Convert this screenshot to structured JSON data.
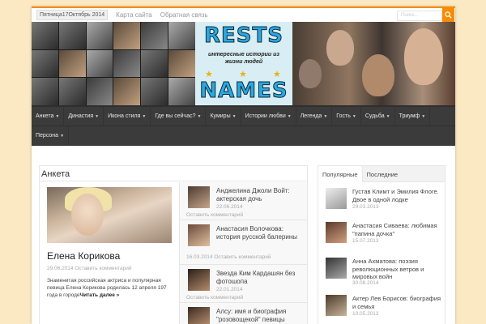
{
  "topbar": {
    "date": "Пятница17Октябрь 2014",
    "links": [
      "Карта сайта",
      "Обратная связь"
    ],
    "search_placeholder": "Поиск..."
  },
  "logo": {
    "top": "RESTS",
    "tagline": "интересные истории из жизни людей",
    "bottom": "NAMES"
  },
  "nav": {
    "row1": [
      "Анкета",
      "Династия",
      "Икона стиля",
      "Где вы сейчас?",
      "Кумиры",
      "Истории любви",
      "Легенда",
      "Гость",
      "Судьба",
      "Триумф"
    ],
    "row2": [
      "Персона"
    ]
  },
  "main": {
    "title": "Анкета",
    "feature": {
      "name": "Елена Корикова",
      "date": "29.06.2014",
      "comment": "Оставить комментарий",
      "text": "Знаменитая российская актриса и популярная певица Елена Корикова родилась 12 апреля 197 года в городе",
      "readmore": "Читать далее »"
    },
    "list": [
      {
        "title": "Анджелина Джоли Войт: актерская дочь",
        "date": "22.06.2014",
        "comment": "Оставить комментарий"
      },
      {
        "title": "Анастасия Волочкова: история русской балерины",
        "date": "16.03.2014",
        "comment": "Оставить комментарий"
      },
      {
        "title": "Звезда Ким Кардашян без фотошопа",
        "date": "22.01.2014",
        "comment": "Оставить комментарий"
      },
      {
        "title": "Алсу: имя и биография \"розовощекой\" певицы",
        "date": "",
        "comment": ""
      }
    ]
  },
  "sidebar": {
    "tabs": [
      "Популярные",
      "Последние"
    ],
    "items": [
      {
        "title": "Густав Климт и Эмилия Флоге. Двое в одной лодке",
        "date": "29.03.2013"
      },
      {
        "title": "Анастасия Сиваева: любимая \"папина дочка\"",
        "date": "15.07.2013"
      },
      {
        "title": "Анна Ахматова: поэзия революционных ветров и мировых войн",
        "date": "30.08.2014"
      },
      {
        "title": "Актер Лев Борисов: биография и семья",
        "date": "10.05.2013"
      }
    ]
  },
  "colors": {
    "accent": "#f88c00",
    "nav_bg": "#3b3b3b",
    "page_bg": "#fbe9c4",
    "logo_text": "#2ca8e0"
  },
  "icons": {
    "search": "search-icon",
    "caret": "caret-down-icon",
    "star": "star-icon"
  }
}
